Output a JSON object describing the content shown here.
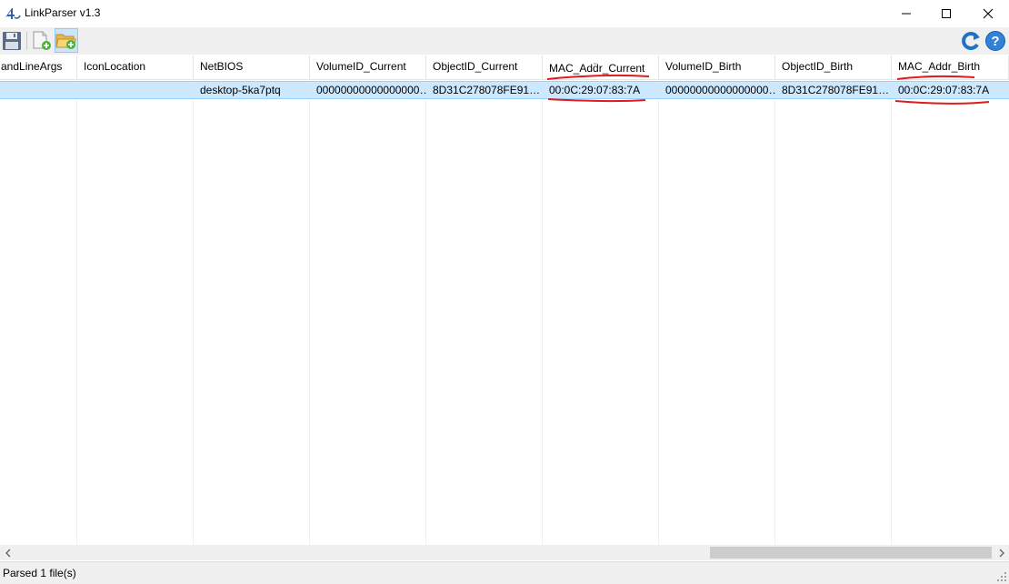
{
  "window": {
    "title": "LinkParser v1.3"
  },
  "toolbar": {
    "buttons": [
      {
        "icon": "save-icon"
      },
      {
        "icon": "new-file-icon"
      },
      {
        "icon": "open-folder-icon"
      },
      {
        "icon": "refresh-icon"
      },
      {
        "icon": "help-icon"
      }
    ]
  },
  "table": {
    "columns": [
      "andLineArgs",
      "IconLocation",
      "NetBIOS",
      "VolumeID_Current",
      "ObjectID_Current",
      "MAC_Addr_Current",
      "VolumeID_Birth",
      "ObjectID_Birth",
      "MAC_Addr_Birth"
    ],
    "rows": [
      [
        "",
        "",
        "desktop-5ka7ptq",
        "00000000000000000…",
        "8D31C278078FE91…",
        "00:0C:29:07:83:7A",
        "00000000000000000…",
        "8D31C278078FE91…",
        "00:0C:29:07:83:7A"
      ]
    ],
    "sorted_column_glyph": "⌄"
  },
  "statusbar": {
    "text": "Parsed 1 file(s)"
  },
  "colors": {
    "selection": "#cce8ff",
    "annotation": "#e11b1b",
    "chrome": "#f0f0f0"
  }
}
